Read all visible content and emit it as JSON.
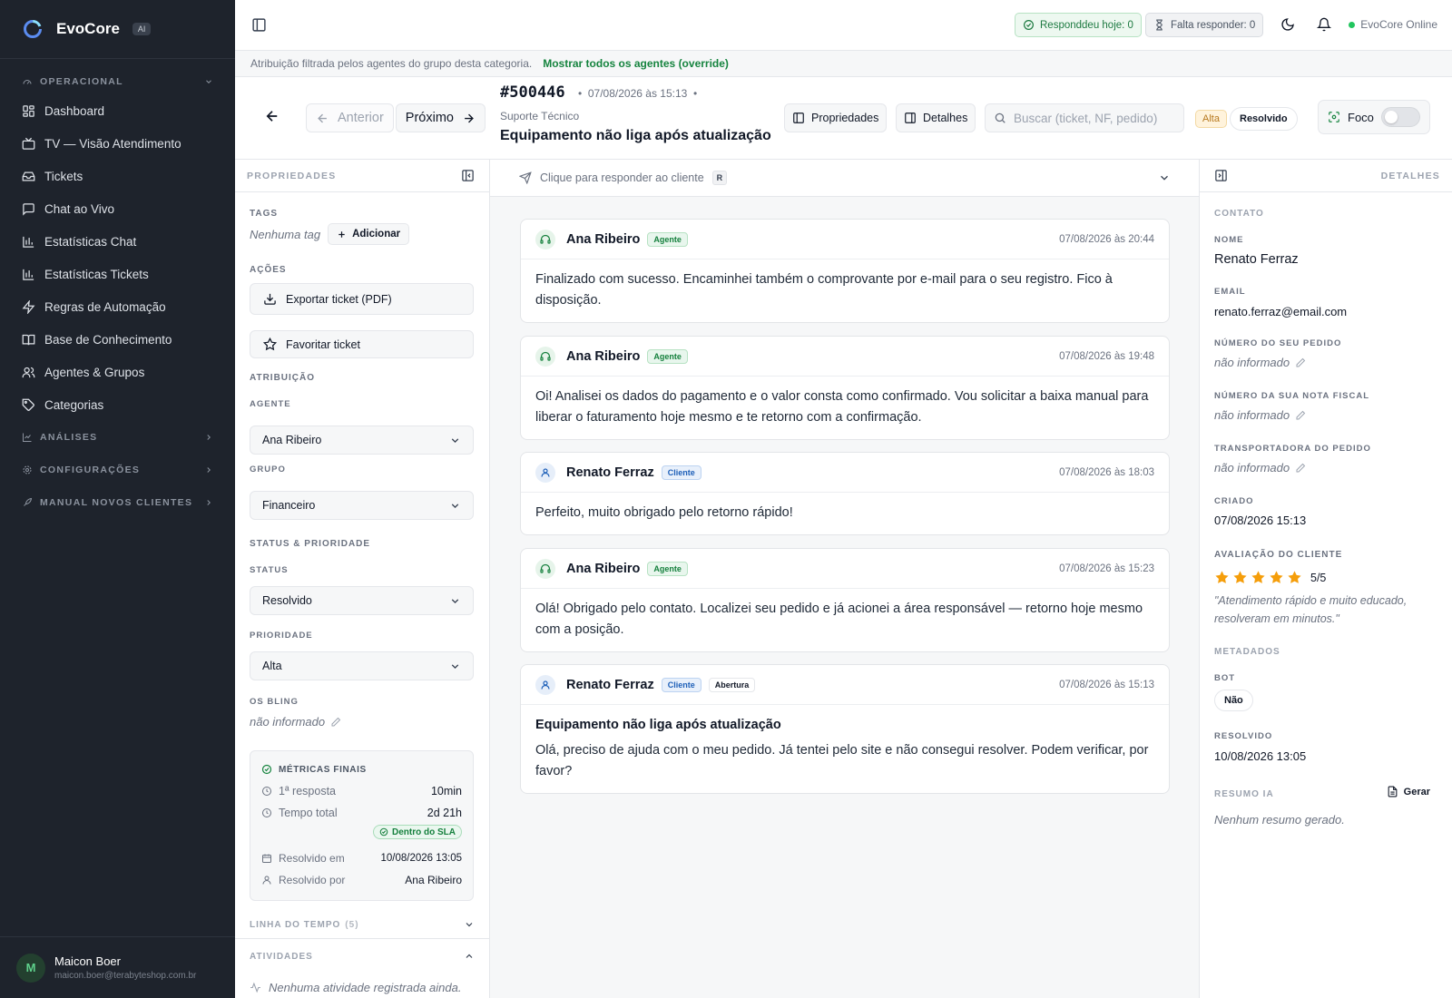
{
  "app": {
    "name": "EvoCore",
    "badge": "AI"
  },
  "sidebar": {
    "sections": {
      "operacional": "OPERACIONAL",
      "analises": "ANÁLISES",
      "configuracoes": "CONFIGURAÇÕES",
      "manual": "MANUAL NOVOS CLIENTES"
    },
    "items": [
      {
        "label": "Dashboard",
        "icon": "dashboard-icon"
      },
      {
        "label": "TV — Visão Atendimento",
        "icon": "tv-icon"
      },
      {
        "label": "Tickets",
        "icon": "inbox-icon"
      },
      {
        "label": "Chat ao Vivo",
        "icon": "chat-icon"
      },
      {
        "label": "Estatísticas Chat",
        "icon": "bar-chart-icon"
      },
      {
        "label": "Estatísticas Tickets",
        "icon": "bar-chart-icon"
      },
      {
        "label": "Regras de Automação",
        "icon": "zap-icon"
      },
      {
        "label": "Base de Conhecimento",
        "icon": "book-icon"
      },
      {
        "label": "Agentes & Grupos",
        "icon": "users-icon"
      },
      {
        "label": "Categorias",
        "icon": "tag-icon"
      }
    ],
    "user": {
      "initial": "M",
      "name": "Maicon Boer",
      "email": "maicon.boer@terabyteshop.com.br"
    }
  },
  "topbar": {
    "answered_today": "Responddeu hoje: 0",
    "pending": "Falta responder: 0",
    "status": "EvoCore Online"
  },
  "banner": {
    "text": "Atribuição filtrada pelos agentes do grupo desta categoria.",
    "link": "Mostrar todos os agentes (override)"
  },
  "ticket": {
    "number": "#500446",
    "date": "07/08/2026 às 15:13",
    "category": "Suporte Técnico",
    "title": "Equipamento não liga após atualização",
    "prev_label": "Anterior",
    "next_label": "Próximo",
    "properties_label": "Propriedades",
    "details_label": "Detalhes",
    "search_placeholder": "Buscar (ticket, NF, pedido)",
    "priority_badge": "Alta",
    "status_badge": "Resolvido",
    "focus_label": "Foco"
  },
  "left_panel": {
    "title": "PROPRIEDADES",
    "tags_label": "TAGS",
    "no_tags": "Nenhuma tag",
    "add_label": "Adicionar",
    "actions_label": "AÇÕES",
    "export_label": "Exportar ticket (PDF)",
    "favorite_label": "Favoritar ticket",
    "assignment_label": "ATRIBUIÇÃO",
    "agent_label": "AGENTE",
    "agent_value": "Ana Ribeiro",
    "group_label": "GRUPO",
    "group_value": "Financeiro",
    "status_priority_label": "STATUS & PRIORIDADE",
    "status_label": "STATUS",
    "status_value": "Resolvido",
    "priority_label": "PRIORIDADE",
    "priority_value": "Alta",
    "os_label": "OS BLING",
    "os_value": "não informado",
    "metrics": {
      "title": "MÉTRICAS FINAIS",
      "first_response_label": "1ª resposta",
      "first_response_value": "10min",
      "total_label": "Tempo total",
      "total_value": "2d 21h",
      "sla": "Dentro do SLA",
      "resolved_at_label": "Resolvido em",
      "resolved_at_value": "10/08/2026 13:05",
      "resolved_by_label": "Resolvido por",
      "resolved_by_value": "Ana Ribeiro"
    },
    "timeline_label": "LINHA DO TEMPO",
    "timeline_count": "(5)",
    "activities_label": "ATIVIDADES",
    "no_activities": "Nenhuma atividade registrada ainda."
  },
  "conversation": {
    "reply_prompt": "Clique para responder ao cliente",
    "reply_key": "R",
    "messages": [
      {
        "author": "Ana Ribeiro",
        "role": "Agente",
        "time": "07/08/2026 às 20:44",
        "body": "Finalizado com sucesso. Encaminhei também o comprovante por e-mail para o seu registro. Fico à disposição."
      },
      {
        "author": "Ana Ribeiro",
        "role": "Agente",
        "time": "07/08/2026 às 19:48",
        "body": "Oi! Analisei os dados do pagamento e o valor consta como confirmado. Vou solicitar a baixa manual para liberar o faturamento hoje mesmo e te retorno com a confirmação."
      },
      {
        "author": "Renato Ferraz",
        "role": "Cliente",
        "time": "07/08/2026 às 18:03",
        "body": "Perfeito, muito obrigado pelo retorno rápido!"
      },
      {
        "author": "Ana Ribeiro",
        "role": "Agente",
        "time": "07/08/2026 às 15:23",
        "body": "Olá! Obrigado pelo contato. Localizei seu pedido e já acionei a área responsável — retorno hoje mesmo com a posição."
      },
      {
        "author": "Renato Ferraz",
        "role": "Cliente",
        "extra_tag": "Abertura",
        "time": "07/08/2026 às 15:13",
        "subject": "Equipamento não liga após atualização",
        "body": "Olá, preciso de ajuda com o meu pedido. Já tentei pelo site e não consegui resolver. Podem verificar, por favor?"
      }
    ]
  },
  "right_panel": {
    "title": "DETALHES",
    "contact_label": "CONTATO",
    "name_label": "NOME",
    "name_value": "Renato Ferraz",
    "email_label": "EMAIL",
    "email_value": "renato.ferraz@email.com",
    "order_label": "NÚMERO DO SEU PEDIDO",
    "order_value": "não informado",
    "invoice_label": "NÚMERO DA SUA NOTA FISCAL",
    "invoice_value": "não informado",
    "carrier_label": "TRANSPORTADORA DO PEDIDO",
    "carrier_value": "não informado",
    "created_label": "CRIADO",
    "created_value": "07/08/2026 15:13",
    "rating_label": "AVALIAÇÃO DO CLIENTE",
    "rating_stars": 5,
    "rating_text": "5/5",
    "rating_comment": "\"Atendimento rápido e muito educado, resolveram em minutos.\"",
    "metadata_label": "METADADOS",
    "bot_label": "BOT",
    "bot_value": "Não",
    "resolved_label": "RESOLVIDO",
    "resolved_value": "10/08/2026 13:05",
    "ai_summary_label": "RESUMO IA",
    "generate_label": "Gerar",
    "no_summary": "Nenhum resumo gerado."
  },
  "colors": {
    "sidebar_bg": "#1e232c",
    "accent_green": "#16843f",
    "star": "#f59e0b",
    "priority_high": "#b7791f"
  }
}
